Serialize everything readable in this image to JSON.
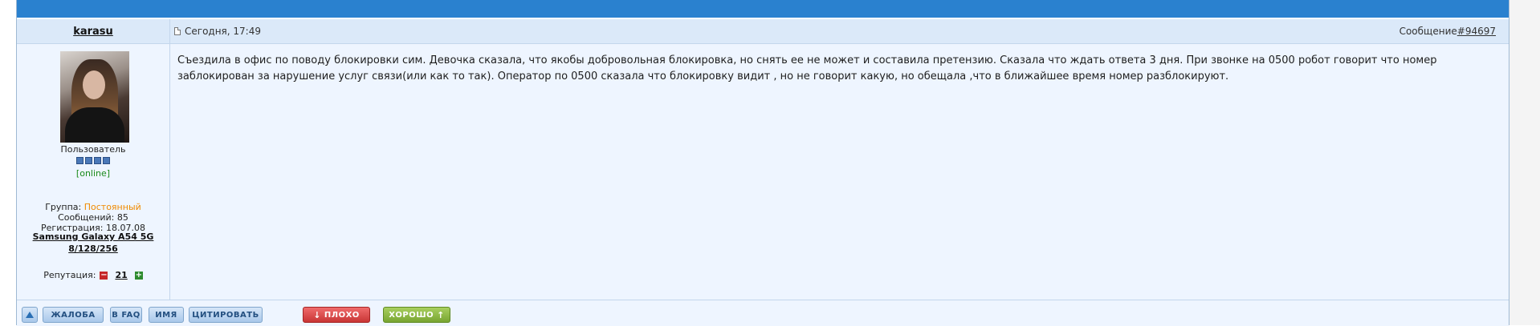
{
  "post": {
    "username": "karasu",
    "date": "Сегодня, 17:49",
    "message_label": "Сообщение ",
    "message_number": "#94697",
    "body": "Съездила в офис по поводу блокировки сим. Девочка сказала, что якобы добровольная блокировка, но снять ее не может и составила претензию. Сказала что ждать ответа 3 дня. При звонке на 0500 робот говорит что номер заблокирован за нарушение услуг связи(или как то так). Оператор по 0500 сказала что блокировку видит , но не говорит какую, но обещала ,что в ближайшее время номер разблокируют."
  },
  "user": {
    "rank": "Пользователь",
    "rank_level": 4,
    "status": "[online]",
    "group_label": "Группа: ",
    "group_value": "Постоянный",
    "posts": "Сообщений: 85",
    "registered": "Регистрация: 18.07.08",
    "device_line1": "Samsung Galaxy A54 5G",
    "device_line2": "8/128/256",
    "reputation_label": "Репутация:",
    "reputation_value": "21"
  },
  "buttons": {
    "complaint": "ЖАЛОБА",
    "faq": "В FAQ",
    "name": "ИМЯ",
    "quote": "ЦИТИРОВАТЬ",
    "bad": "ПЛОХО",
    "good": "ХОРОШО"
  },
  "colors": {
    "top_bar": "#2a81cf",
    "header_bg": "#dbe9f9",
    "post_bg": "#eef5ff",
    "group_value": "#f08a00",
    "online": "#1a8a1a",
    "bad_button": "#c93535",
    "good_button": "#78a532"
  }
}
